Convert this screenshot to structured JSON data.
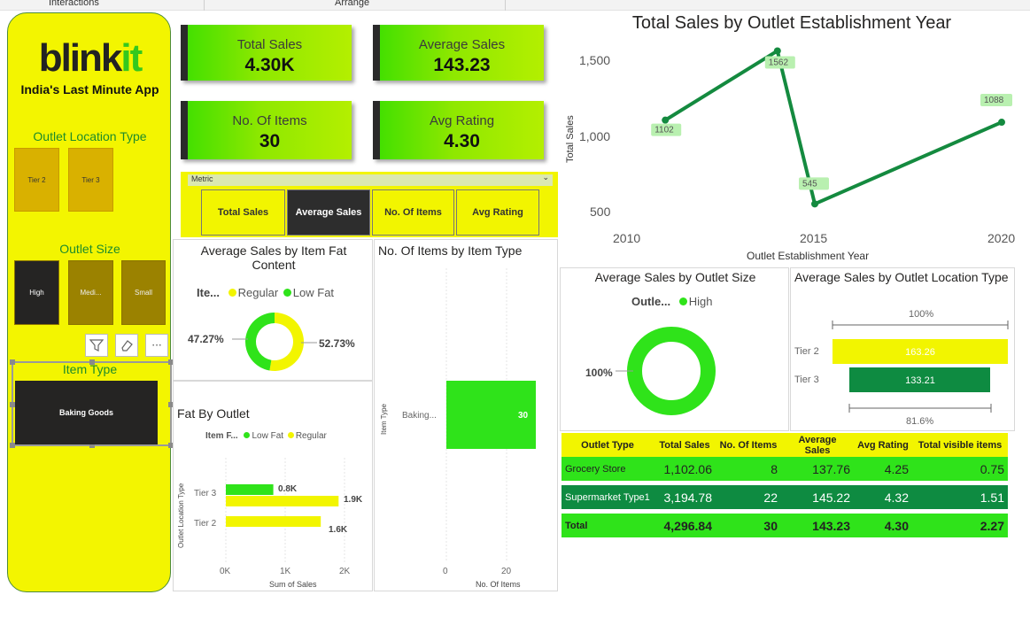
{
  "topbar": {
    "left_label": "Interactions",
    "center_label": "Arrange"
  },
  "brand": {
    "logo_main": "blink",
    "logo_accent": "it",
    "tagline": "India's Last Minute App"
  },
  "filters": {
    "location_title": "Outlet Location Type",
    "location_options": [
      "Tier 2",
      "Tier 3"
    ],
    "size_title": "Outlet Size",
    "size_options": [
      {
        "label": "High",
        "selected": true
      },
      {
        "label": "Medi...",
        "selected": false
      },
      {
        "label": "Small",
        "selected": false
      }
    ],
    "item_type_title": "Item Type",
    "item_type_value": "Baking Goods",
    "tools": {
      "filter_icon": "funnel-icon",
      "eraser_icon": "eraser-icon",
      "more_icon": "more-icon",
      "more_glyph": "···"
    }
  },
  "kpis": [
    {
      "label": "Total Sales",
      "value": "4.30K"
    },
    {
      "label": "Average Sales",
      "value": "143.23"
    },
    {
      "label": "No. Of Items",
      "value": "30"
    },
    {
      "label": "Avg Rating",
      "value": "4.30"
    }
  ],
  "metric_slicer": {
    "header": "Metric",
    "options": [
      {
        "label": "Total Sales",
        "selected": false
      },
      {
        "label": "Average Sales",
        "selected": true
      },
      {
        "label": "No. Of Items",
        "selected": false
      },
      {
        "label": "Avg Rating",
        "selected": false
      }
    ]
  },
  "fat_donut": {
    "title": "Average Sales by Item Fat Content",
    "legend_label": "Ite...",
    "legend": [
      "Regular",
      "Low Fat"
    ],
    "left_label": "47.27%",
    "right_label": "52.73%"
  },
  "fat_outlet": {
    "title": "Fat By Outlet",
    "legend_label": "Item F...",
    "legend": [
      "Low Fat",
      "Regular"
    ],
    "y_axis_title": "Outlet Location Type",
    "x_axis_title": "Sum of Sales",
    "x_ticks": [
      "0K",
      "1K",
      "2K"
    ],
    "bar_labels": [
      "0.8K",
      "1.9K",
      "1.6K"
    ]
  },
  "items_by_type": {
    "title": "No. Of Items by Item Type",
    "y_axis_title": "Item Type",
    "x_axis_title": "No. Of Items",
    "category_label": "Baking...",
    "value_label": "30",
    "x_ticks": [
      "0",
      "20"
    ]
  },
  "line_chart_text": {
    "title": "Total Sales by Outlet Establishment Year",
    "xlabel": "Outlet Establishment Year",
    "ylabel": "Total Sales",
    "y_ticks": [
      "1,500",
      "1,000",
      "500"
    ],
    "x_ticks": [
      "2010",
      "2015",
      "2020"
    ],
    "point_labels": [
      "1102",
      "1562",
      "545",
      "1088"
    ]
  },
  "size_donut": {
    "title": "Average Sales by Outlet Size",
    "legend_label": "Outle...",
    "legend": [
      "High"
    ],
    "label": "100%"
  },
  "location_bars": {
    "title": "Average Sales by Outlet Location Type",
    "top_pct": "100%",
    "bottom_pct": "81.6%",
    "rows": [
      {
        "label": "Tier 2",
        "value_label": "163.26"
      },
      {
        "label": "Tier 3",
        "value_label": "133.21"
      }
    ]
  },
  "table": {
    "headers": [
      "Outlet Type",
      "Total Sales",
      "No. Of Items",
      "Average Sales",
      "Avg Rating",
      "Total visible items"
    ],
    "rows": [
      [
        "Grocery Store",
        "1,102.06",
        "8",
        "137.76",
        "4.25",
        "0.75"
      ],
      [
        "Supermarket Type1",
        "3,194.78",
        "22",
        "145.22",
        "4.32",
        "1.51"
      ]
    ],
    "total": [
      "Total",
      "4,296.84",
      "30",
      "143.23",
      "4.30",
      "2.27"
    ]
  },
  "colors": {
    "yellow": "#f2f500",
    "green": "#2fe31a",
    "dark_green": "#0e8b41",
    "line": "#148a3f"
  },
  "chart_data": [
    {
      "type": "line",
      "title": "Total Sales by Outlet Establishment Year",
      "xlabel": "Outlet Establishment Year",
      "ylabel": "Total Sales",
      "x": [
        2011,
        2014,
        2015,
        2020
      ],
      "series": [
        {
          "values": [
            1102,
            1562,
            545,
            1088
          ]
        }
      ],
      "xlim": [
        2010,
        2020
      ],
      "ylim": [
        400,
        1650
      ]
    },
    {
      "type": "pie",
      "title": "Average Sales by Item Fat Content",
      "categories": [
        "Regular",
        "Low Fat"
      ],
      "values": [
        52.73,
        47.27
      ]
    },
    {
      "type": "bar",
      "title": "Fat By Outlet",
      "categories": [
        "Tier 3",
        "Tier 2"
      ],
      "series": [
        {
          "name": "Low Fat",
          "values": [
            0.8,
            0
          ]
        },
        {
          "name": "Regular",
          "values": [
            1.9,
            1.6
          ]
        }
      ],
      "xlabel": "Sum of Sales",
      "ylabel": "Outlet Location Type",
      "xlim": [
        0,
        2
      ]
    },
    {
      "type": "bar",
      "title": "No. Of Items by Item Type",
      "categories": [
        "Baking..."
      ],
      "values": [
        30
      ],
      "xlabel": "No. Of Items",
      "ylabel": "Item Type",
      "xlim": [
        0,
        30
      ]
    },
    {
      "type": "pie",
      "title": "Average Sales by Outlet Size",
      "categories": [
        "High"
      ],
      "values": [
        100
      ]
    },
    {
      "type": "bar",
      "title": "Average Sales by Outlet Location Type",
      "categories": [
        "Tier 2",
        "Tier 3"
      ],
      "values": [
        163.26,
        133.21
      ]
    }
  ]
}
